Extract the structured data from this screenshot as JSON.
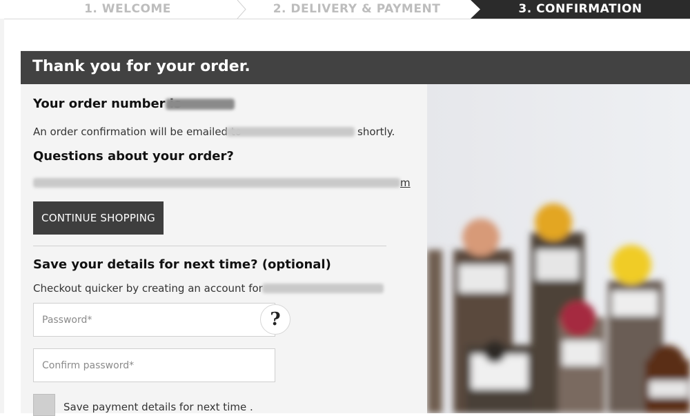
{
  "steps": [
    {
      "label": "1. WELCOME",
      "state": "done"
    },
    {
      "label": "2. DELIVERY & PAYMENT",
      "state": "done"
    },
    {
      "label": "3. CONFIRMATION",
      "state": "active"
    }
  ],
  "confirmation": {
    "title": "Thank you for your order.",
    "order_number_label": "Your order number is",
    "email_notice_prefix": "An order confirmation will be emailed to",
    "email_notice_suffix": "shortly.",
    "questions_heading": "Questions about your order?",
    "contact_suffix": "m",
    "continue_button": "CONTINUE SHOPPING"
  },
  "account": {
    "heading": "Save your details for next time? (optional)",
    "checkout_text": "Checkout quicker by creating an account for",
    "password_placeholder": "Password*",
    "confirm_placeholder": "Confirm password*",
    "help_label": "?",
    "save_payment_label": "Save payment details for next time ."
  },
  "colors": {
    "title_bar": "#424242",
    "active_step": "#2b2b2b",
    "inactive_step_text": "#bdbdbd",
    "panel_bg": "#f4f4f4"
  },
  "icons": {
    "help": "question-mark-icon",
    "step_separator": "chevron-right-icon"
  }
}
